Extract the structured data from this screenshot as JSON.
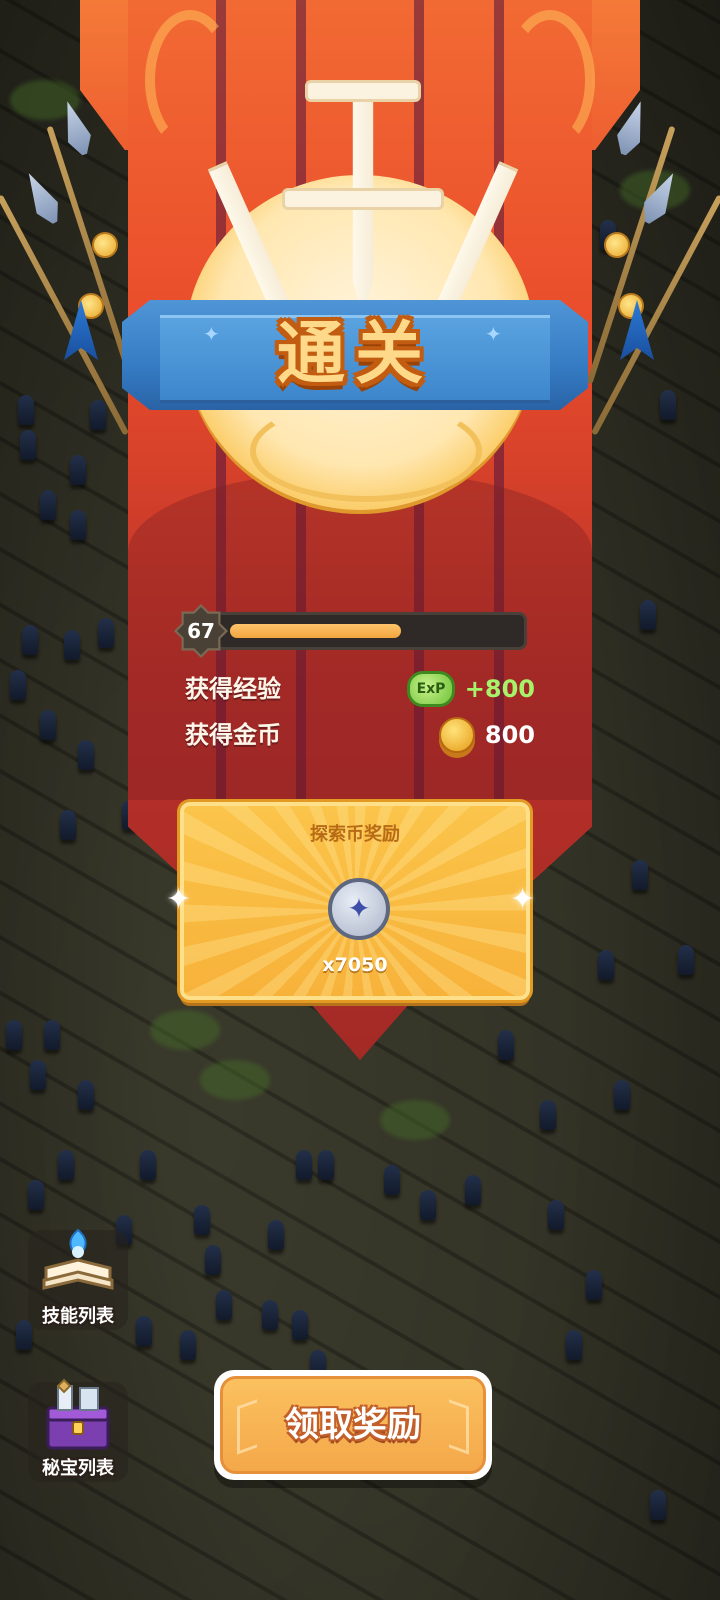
{
  "title": "通关",
  "level": {
    "value": "67",
    "progress": 0.55
  },
  "rewards": {
    "exp": {
      "label": "获得经验",
      "icon_text": "ExP",
      "value": "+800",
      "color": "#a6f26a"
    },
    "gold": {
      "label": "获得金币",
      "value": "800",
      "color": "#ffffff"
    }
  },
  "explore_panel": {
    "title": "探索币奖励",
    "count": "x7050",
    "icon": "compass-coin-icon"
  },
  "side_buttons": {
    "skills": {
      "label": "技能列表",
      "icon": "spellbook-icon"
    },
    "treasures": {
      "label": "秘宝列表",
      "icon": "treasure-chest-icon"
    }
  },
  "claim_button": {
    "label": "领取奖励"
  },
  "colors": {
    "banner": "#ea4d2c",
    "ribbon": "#357cc4",
    "title": "#ffd98a",
    "panel": "#f7b23a",
    "button": "#f4a84a"
  }
}
